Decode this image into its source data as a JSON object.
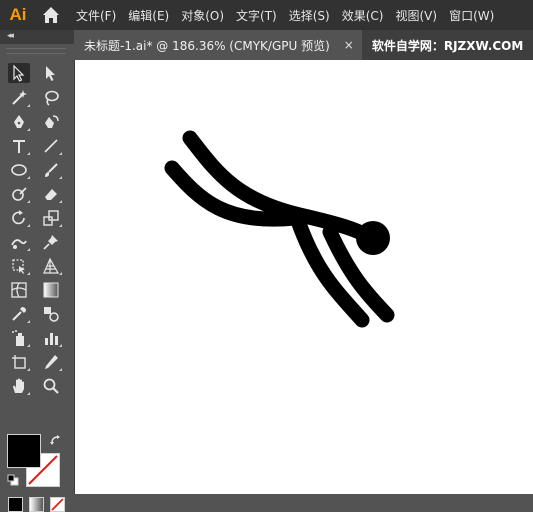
{
  "app": {
    "logo_text": "Ai"
  },
  "menu": [
    "文件(F)",
    "编辑(E)",
    "对象(O)",
    "文字(T)",
    "选择(S)",
    "效果(C)",
    "视图(V)",
    "窗口(W)"
  ],
  "toolbar": {
    "collapse_label": "◂◂",
    "tools": [
      "selection-tool",
      "direct-selection-tool",
      "magic-wand-tool",
      "lasso-tool",
      "pen-tool",
      "curvature-tool",
      "type-tool",
      "line-segment-tool",
      "ellipse-tool",
      "paintbrush-tool",
      "shaper-tool",
      "eraser-tool",
      "rotate-tool",
      "scale-tool",
      "puppet-warp-tool",
      "pin-tool",
      "free-transform-tool",
      "perspective-grid-tool",
      "mesh-tool",
      "gradient-tool",
      "eyedropper-tool",
      "blend-tool",
      "symbol-sprayer-tool",
      "column-graph-tool",
      "artboard-tool",
      "slice-tool",
      "hand-tool",
      "zoom-tool"
    ],
    "fill_color": "#000000",
    "stroke_color": "#ffffff"
  },
  "tabs": [
    {
      "label": "未标题-1.ai* @ 186.36% (CMYK/GPU 预览)",
      "close": "×"
    },
    {
      "label": "软件自学网：RJZXW.COM"
    }
  ],
  "colors": {
    "menubar_bg": "#323232",
    "panel_bg": "#535353",
    "canvas_bg": "#ffffff",
    "artwork": "#000000",
    "logo": "#ff9a00"
  }
}
